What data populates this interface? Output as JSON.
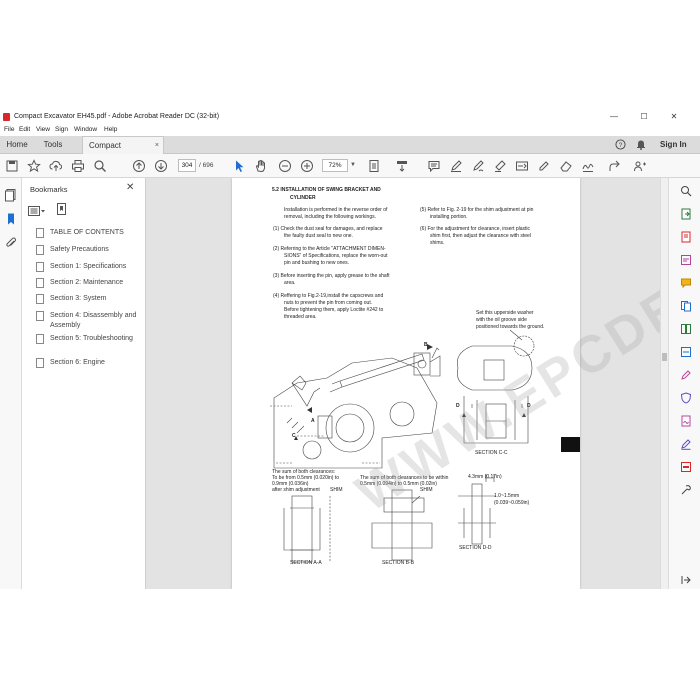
{
  "window": {
    "title": "Compact Excavator EH45.pdf - Adobe Acrobat Reader DC (32-bit)",
    "minimize": "—",
    "maximize": "☐",
    "close": "✕"
  },
  "menu": [
    "File",
    "Edit",
    "View",
    "Sign",
    "Window",
    "Help"
  ],
  "tabs": {
    "home": "Home",
    "tools": "Tools",
    "document": "Compact Excavator...",
    "close": "×"
  },
  "signin": "Sign In",
  "toolbar": {
    "page_current": "304",
    "page_total": "/ 696",
    "zoom": "72%"
  },
  "bookmarks": {
    "title": "Bookmarks",
    "close": "✕",
    "items": [
      {
        "label": "TABLE OF CONTENTS"
      },
      {
        "label": "Safety Precautions"
      },
      {
        "label": "Section 1:  Specifications"
      },
      {
        "label": "Section 2: Maintenance"
      },
      {
        "label": "Section 3: System"
      },
      {
        "label": "Section 4: Disassembly and Assembly"
      },
      {
        "label": "Section 5: Troubleshooting"
      },
      {
        "label": "Section 6: Engine"
      }
    ]
  },
  "document": {
    "heading_1": "5.2  INSTALLATION OF SWING BRACKET AND",
    "heading_2": "CYLINDER",
    "intro_1": "Installation is performed in the reverse order of",
    "intro_2": "removal, including the following workings.",
    "s1_1": "(1)  Check the dust seal for damages, and replace",
    "s1_2": "the faulty dust seal to new one.",
    "s2_1": "(2)  Referring to the Article \"ATTACHMENT DIMEN-",
    "s2_2": "SIONS\" of Specifications, replace the worn-out",
    "s2_3": "pin and bushing to new ones.",
    "s3_1": "(3)  Before inserting the pin, apply grease to the shaft",
    "s3_2": "area.",
    "s4_1": "(4)  Reffering to Fig.2-19,install the capscrews and",
    "s4_2": "nuts to prevent the pin from coming out.",
    "s4_3": "Before tightening them, apply Loctite #242 to",
    "s4_4": "threaded area.",
    "s5_1": "(5)  Refer to Fig. 2-19 for the shim adjustment at pin",
    "s5_2": "installing portion.",
    "s6_1": "(6)  For the adjustment for clearance, insert plastic",
    "s6_2": "shim first, then adjust the clearance with steel",
    "s6_3": "shims.",
    "note_washer_1": "Set this upperside washer",
    "note_washer_2": "with the oil groove side",
    "note_washer_3": "positioned towards the ground.",
    "label_b": "B",
    "label_a": "A",
    "label_c": "C",
    "label_d": "D",
    "section_cc": "SECTION  C-C",
    "note_a_1": "The sum of both clearances:",
    "note_a_2": "To be from 0.5mm (0.020in) to",
    "note_a_3": "0.9mm (0.036in)",
    "note_a_4": "after shim adjustment",
    "shim": "SHIM",
    "note_b_1": "The sum of both clearances to be within",
    "note_b_2": "0.5mm (0.094in) to 0.5mm (0.02in)",
    "dim_1": "4.3mm (0.17in)",
    "dim_2": "1.0~1.5mm",
    "dim_3": "(0.039~0.059in)",
    "section_aa": "SECTION  A-A",
    "section_bb": "SECTION  B-B",
    "section_dd": "SECTION  D-D"
  },
  "watermark": "WWW.EPCDEPO.COM",
  "colors": {
    "accent_red": "#d9282b",
    "tab_bar": "#dcdcdc",
    "viewer_bg": "#e3e3e3"
  }
}
